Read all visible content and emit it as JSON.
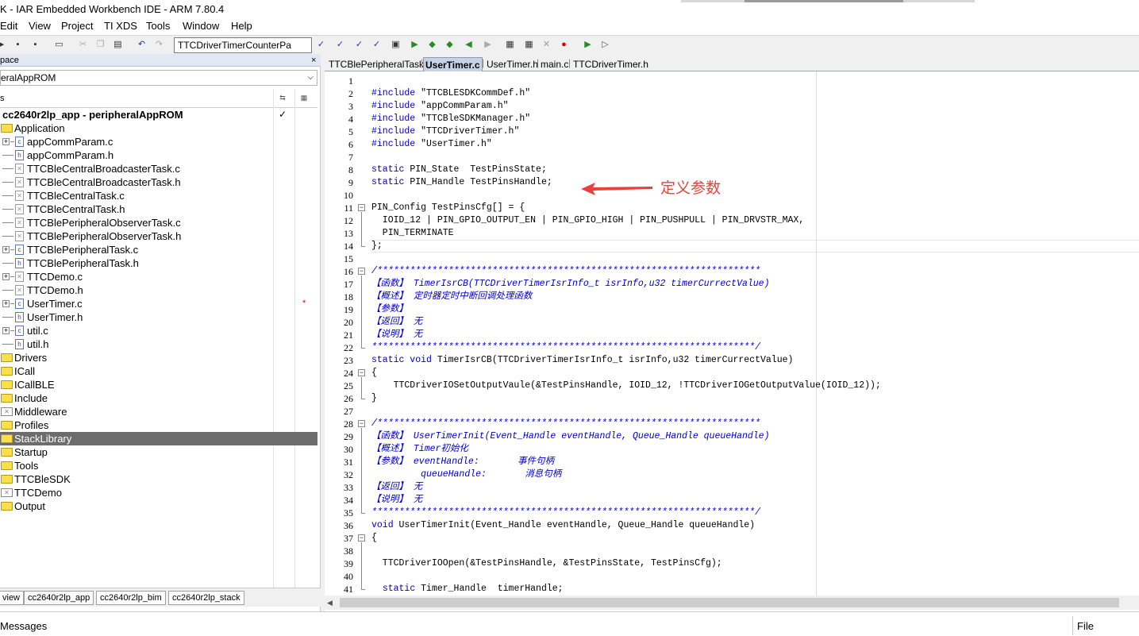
{
  "window": {
    "title": "K - IAR Embedded Workbench IDE - ARM 7.80.4"
  },
  "menu": [
    "Edit",
    "View",
    "Project",
    "TI XDS",
    "Tools",
    "Window",
    "Help"
  ],
  "toolbar": {
    "combo_value": "TTCDriverTimerCounterPa"
  },
  "workspace": {
    "header": "pace",
    "close": "×",
    "config": "eralAppROM",
    "files_col": "s",
    "project": "cc2640r2lp_app - peripheralAppROM",
    "project_check": "✓",
    "tree": [
      {
        "label": "Application",
        "type": "folder",
        "open": true
      },
      {
        "label": "appCommParam.c",
        "type": "file",
        "exp": true
      },
      {
        "label": "appCommParam.h",
        "type": "file"
      },
      {
        "label": "TTCBleCentralBroadcasterTask.c",
        "type": "excluded"
      },
      {
        "label": "TTCBleCentralBroadcasterTask.h",
        "type": "excluded"
      },
      {
        "label": "TTCBleCentralTask.c",
        "type": "excluded"
      },
      {
        "label": "TTCBleCentralTask.h",
        "type": "excluded"
      },
      {
        "label": "TTCBlePeripheralObserverTask.c",
        "type": "excluded"
      },
      {
        "label": "TTCBlePeripheralObserverTask.h",
        "type": "excluded"
      },
      {
        "label": "TTCBlePeripheralTask.c",
        "type": "file",
        "exp": true
      },
      {
        "label": "TTCBlePeripheralTask.h",
        "type": "file"
      },
      {
        "label": "TTCDemo.c",
        "type": "excluded",
        "exp": true
      },
      {
        "label": "TTCDemo.h",
        "type": "excluded"
      },
      {
        "label": "UserTimer.c",
        "type": "file",
        "exp": true,
        "star": "*"
      },
      {
        "label": "UserTimer.h",
        "type": "file"
      },
      {
        "label": "util.c",
        "type": "file",
        "exp": true
      },
      {
        "label": "util.h",
        "type": "file"
      },
      {
        "label": "Drivers",
        "type": "folder"
      },
      {
        "label": "ICall",
        "type": "folder"
      },
      {
        "label": "ICallBLE",
        "type": "folder"
      },
      {
        "label": "Include",
        "type": "folder"
      },
      {
        "label": "Middleware",
        "type": "folderx"
      },
      {
        "label": "Profiles",
        "type": "folder"
      },
      {
        "label": "StackLibrary",
        "type": "folder",
        "selected": true
      },
      {
        "label": "Startup",
        "type": "folder"
      },
      {
        "label": "Tools",
        "type": "folder"
      },
      {
        "label": "TTCBleSDK",
        "type": "folder"
      },
      {
        "label": "TTCDemo",
        "type": "folderx"
      },
      {
        "label": "Output",
        "type": "folder"
      }
    ],
    "tabs": [
      "view",
      "cc2640r2lp_app",
      "cc2640r2lp_bim",
      "cc2640r2lp_stack"
    ]
  },
  "editor": {
    "tabs": [
      "TTCBlePeripheralTask.c",
      "UserTimer.c",
      "UserTimer.h",
      "main.c",
      "TTCDriverTimer.h"
    ],
    "active_tab": 1,
    "line_numbers": [
      "1",
      "2",
      "3",
      "4",
      "5",
      "6",
      "7",
      "8",
      "9",
      "10",
      "11",
      "12",
      "13",
      "14",
      "15",
      "16",
      "17",
      "18",
      "19",
      "20",
      "21",
      "22",
      "23",
      "24",
      "25",
      "26",
      "27",
      "28",
      "29",
      "30",
      "31",
      "32",
      "33",
      "34",
      "35",
      "36",
      "37",
      "38",
      "39",
      "40",
      "41"
    ],
    "lines": [
      "",
      "#include \"TTCBLESDKCommDef.h\"",
      "#include \"appCommParam.h\"",
      "#include \"TTCBleSDKManager.h\"",
      "#include \"TTCDriverTimer.h\"",
      "#include \"UserTimer.h\"",
      "",
      "static PIN_State  TestPinsState;",
      "static PIN_Handle TestPinsHandle;",
      "",
      "PIN_Config TestPinsCfg[] = {",
      "  IOID_12 | PIN_GPIO_OUTPUT_EN | PIN_GPIO_HIGH | PIN_PUSHPULL | PIN_DRVSTR_MAX,",
      "  PIN_TERMINATE",
      "};",
      "",
      "/**********************************************************************",
      "【函数】 TimerIsrCB(TTCDriverTimerIsrInfo_t isrInfo,u32 timerCurrectValue)",
      "【概述】 定时器定时中断回调处理函数",
      "【参数】",
      "【返回】 无",
      "【说明】 无",
      "**********************************************************************/",
      "static void TimerIsrCB(TTCDriverTimerIsrInfo_t isrInfo,u32 timerCurrectValue)",
      "{",
      "    TTCDriverIOSetOutputVaule(&TestPinsHandle, IOID_12, !TTCDriverIOGetOutputValue(IOID_12));",
      "}",
      "",
      "/**********************************************************************",
      "【函数】 UserTimerInit(Event_Handle eventHandle, Queue_Handle queueHandle)",
      "【概述】 Timer初始化",
      "【参数】 eventHandle:       事件句柄",
      "         queueHandle:       消息句柄",
      "【返回】 无",
      "【说明】 无",
      "**********************************************************************/",
      "void UserTimerInit(Event_Handle eventHandle, Queue_Handle queueHandle)",
      "{",
      "",
      "  TTCDriverIOOpen(&TestPinsHandle, &TestPinsState, TestPinsCfg);",
      "",
      "  static Timer_Handle  timerHandle;"
    ]
  },
  "annotation": {
    "text": "定义参数",
    "color": "#e8413c"
  },
  "bottom": {
    "messages": "Messages",
    "file": "File"
  }
}
